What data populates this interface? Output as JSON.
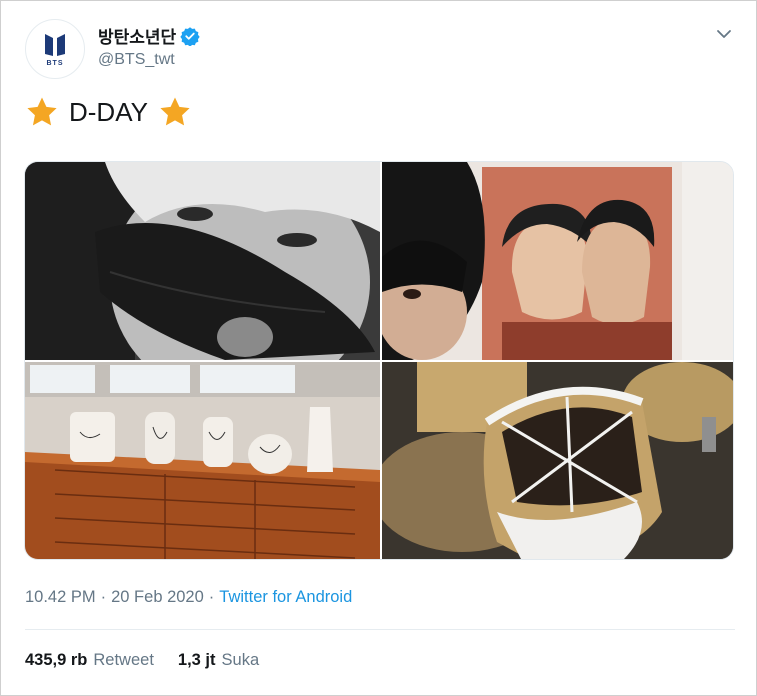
{
  "tweet": {
    "display_name": "방탄소년단",
    "handle": "@BTS_twt",
    "avatar_logo_text": "BTS",
    "text": "D-DAY",
    "emoji": "star",
    "time": "10.42 PM",
    "date": "20 Feb 2020",
    "separator": "·",
    "source": "Twitter for Android",
    "retweets": {
      "count": "435,9 rb",
      "label": "Retweet"
    },
    "likes": {
      "count": "1,3 jt",
      "label": "Suka"
    }
  },
  "icons": {
    "verified": "verified-badge-icon",
    "caret": "chevron-down-icon",
    "emoji": "star-icon"
  },
  "colors": {
    "verified": "#1da1f2",
    "link": "#1b95e0",
    "muted": "#657786",
    "star": "#f4a623"
  },
  "media": [
    {
      "description": "black and white selfie with face mask"
    },
    {
      "description": "selfie with bucket hat in front of painting"
    },
    {
      "description": "ceramic vases on wooden dresser"
    },
    {
      "description": "snowy straw plant covers"
    }
  ]
}
